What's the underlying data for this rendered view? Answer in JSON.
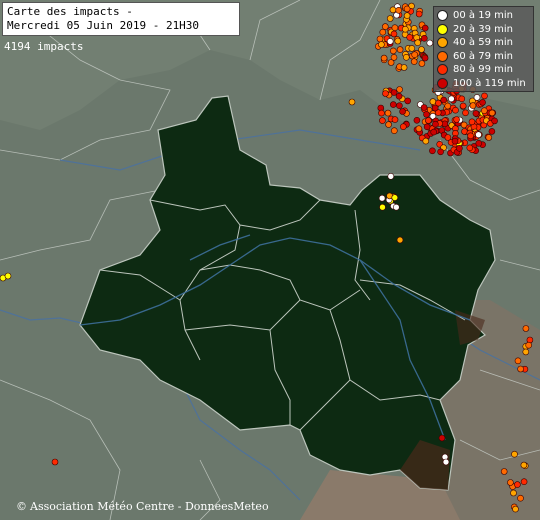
{
  "title": {
    "line1": "Carte des impacts -",
    "line2": "Mercredi 05 Juin 2019 - 21H30"
  },
  "impact_count": "4194 impacts",
  "legend": [
    {
      "label": "00 à 19 min",
      "color": "#ffffff"
    },
    {
      "label": "20 à 39 min",
      "color": "#ffff00"
    },
    {
      "label": "40 à 59 min",
      "color": "#ffa500"
    },
    {
      "label": "60 à 79 min",
      "color": "#ff6a00"
    },
    {
      "label": "80 à 99 min",
      "color": "#ff2a00"
    },
    {
      "label": "100 à 119 min",
      "color": "#cc0000"
    }
  ],
  "copyright": {
    "symbol": "©",
    "text": "Association Météo Centre - DonneesMeteo"
  },
  "colors": {
    "region_fill": "#0d2a12",
    "outside_fill": "#6c7a6c",
    "river": "#4a6f9a",
    "border": "#bfc7bf"
  }
}
